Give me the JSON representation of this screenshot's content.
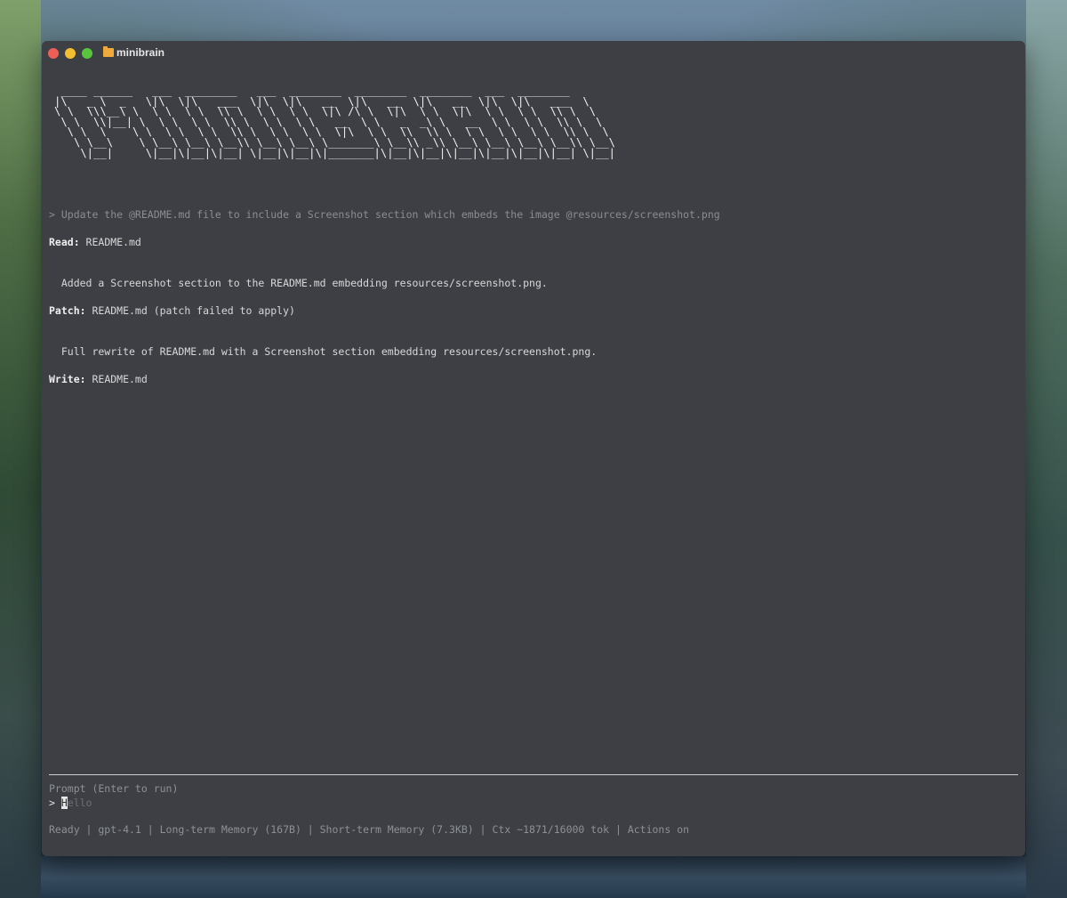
{
  "window": {
    "title": "minibrain"
  },
  "banner": " ____ ______   ___  ________   ___  ________  ________  ________  ___  ________\n|\\   _ \\  _   \\|\\  \\|\\   ___  \\|\\  \\|\\   __  \\|\\   __  \\|\\   __  \\|\\  \\|\\   ___  \\\n\\ \\  \\\\\\__\\ \\  \\ \\  \\ \\  \\\\ \\  \\ \\  \\ \\  \\|\\ /\\ \\  \\|\\  \\ \\  \\|\\  \\ \\  \\ \\  \\\\ \\  \\\n \\ \\  \\\\|__| \\  \\ \\  \\ \\  \\\\ \\  \\ \\  \\ \\   __  \\ \\   _  _\\ \\   __  \\ \\  \\ \\  \\\\ \\  \\\n  \\ \\  \\    \\ \\  \\ \\  \\ \\  \\\\ \\  \\ \\  \\ \\  \\|\\  \\ \\  \\\\  \\\\ \\  \\ \\  \\ \\  \\ \\  \\\\ \\  \\\n   \\ \\__\\    \\ \\__\\ \\__\\ \\__\\\\ \\__\\ \\__\\ \\_______\\ \\__\\\\ _\\\\ \\__\\ \\__\\ \\__\\ \\__\\\\ \\__\\\n    \\|__|     \\|__|\\|__|\\|__| \\|__|\\|__|\\|_______|\\|__|\\|__|\\|__|\\|__|\\|__|\\|__| \\|__|",
  "transcript": {
    "user_prompt": "> Update the @README.md file to include a Screenshot section which embeds the image @resources/screenshot.png",
    "read_label": "Read:",
    "read_value": " README.md",
    "message1": "  Added a Screenshot section to the README.md embedding resources/screenshot.png.",
    "patch_label": "Patch:",
    "patch_value": " README.md (patch failed to apply)",
    "message2": "  Full rewrite of README.md with a Screenshot section embedding resources/screenshot.png.",
    "write_label": "Write:",
    "write_value": " README.md"
  },
  "prompt": {
    "label": "Prompt (Enter to run)",
    "marker": "> ",
    "cursor_char": "H",
    "placeholder_rest": "ello"
  },
  "status_bar": "Ready | gpt-4.1 | Long-term Memory (167B) | Short-term Memory (7.3KB) | Ctx ~1871/16000 tok | Actions on"
}
